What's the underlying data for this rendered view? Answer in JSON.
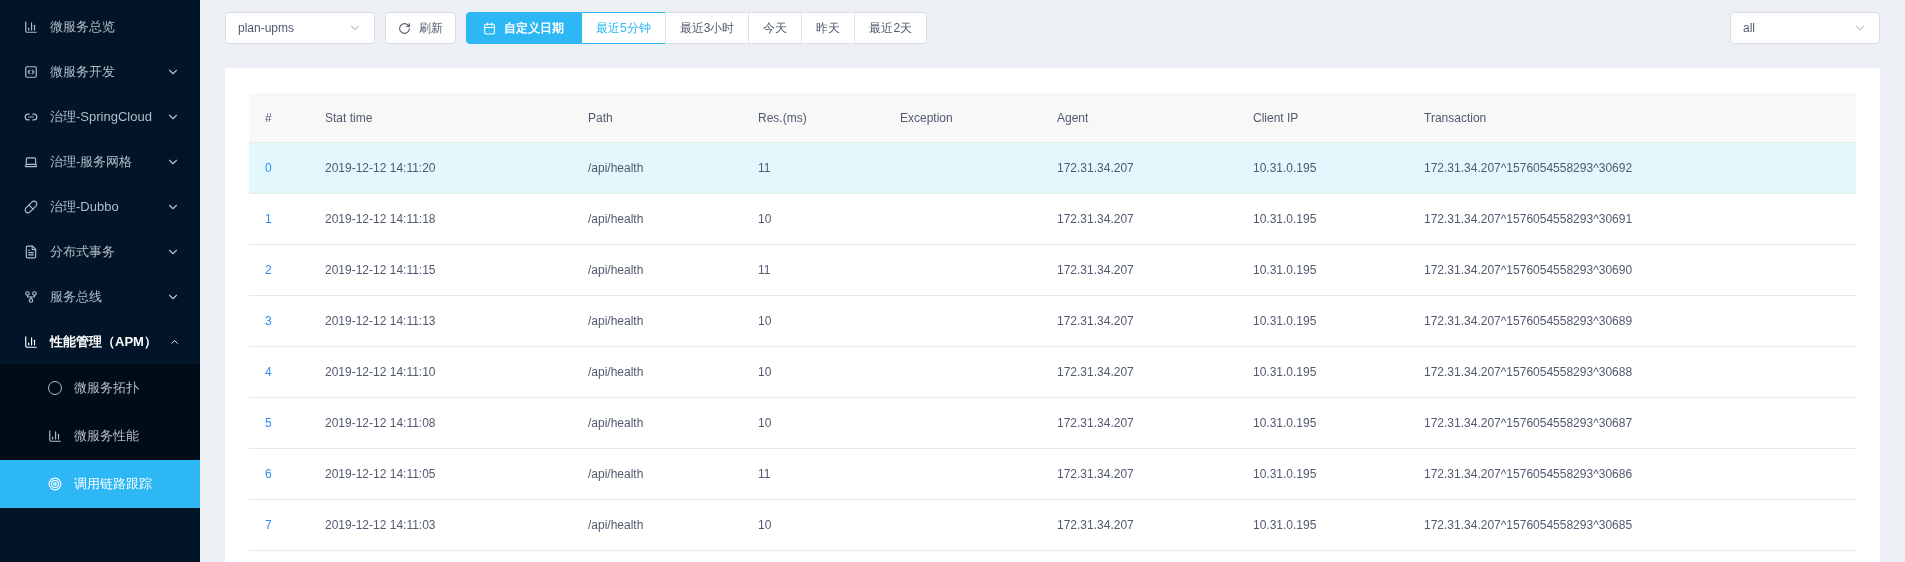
{
  "sidebar": {
    "items": [
      {
        "label": "微服务总览",
        "kind": "link",
        "expanded": false
      },
      {
        "label": "微服务开发",
        "kind": "group",
        "expanded": false
      },
      {
        "label": "治理-SpringCloud",
        "kind": "group",
        "expanded": false
      },
      {
        "label": "治理-服务网格",
        "kind": "group",
        "expanded": false
      },
      {
        "label": "治理-Dubbo",
        "kind": "group",
        "expanded": false
      },
      {
        "label": "分布式事务",
        "kind": "group",
        "expanded": false
      },
      {
        "label": "服务总线",
        "kind": "group",
        "expanded": false
      },
      {
        "label": "性能管理（APM）",
        "kind": "group",
        "expanded": true,
        "children": [
          {
            "label": "微服务拓扑",
            "selected": false
          },
          {
            "label": "微服务性能",
            "selected": false
          },
          {
            "label": "调用链路跟踪",
            "selected": true
          }
        ]
      }
    ]
  },
  "toolbar": {
    "service_select": {
      "value": "plan-upms"
    },
    "refresh_button": "刷新",
    "custom_date_button": "自定义日期",
    "ranges": [
      {
        "label": "最近5分钟",
        "selected": true
      },
      {
        "label": "最近3小时",
        "selected": false
      },
      {
        "label": "今天",
        "selected": false
      },
      {
        "label": "昨天",
        "selected": false
      },
      {
        "label": "最近2天",
        "selected": false
      }
    ],
    "filter_select": {
      "value": "all"
    }
  },
  "table": {
    "columns": [
      "#",
      "Stat time",
      "Path",
      "Res.(ms)",
      "Exception",
      "Agent",
      "Client IP",
      "Transaction"
    ],
    "rows": [
      {
        "selected": true,
        "cells": [
          "0",
          "2019-12-12 14:11:20",
          "/api/health",
          "11",
          "",
          "172.31.34.207",
          "10.31.0.195",
          "172.31.34.207^1576054558293^30692"
        ]
      },
      {
        "selected": false,
        "cells": [
          "1",
          "2019-12-12 14:11:18",
          "/api/health",
          "10",
          "",
          "172.31.34.207",
          "10.31.0.195",
          "172.31.34.207^1576054558293^30691"
        ]
      },
      {
        "selected": false,
        "cells": [
          "2",
          "2019-12-12 14:11:15",
          "/api/health",
          "11",
          "",
          "172.31.34.207",
          "10.31.0.195",
          "172.31.34.207^1576054558293^30690"
        ]
      },
      {
        "selected": false,
        "cells": [
          "3",
          "2019-12-12 14:11:13",
          "/api/health",
          "10",
          "",
          "172.31.34.207",
          "10.31.0.195",
          "172.31.34.207^1576054558293^30689"
        ]
      },
      {
        "selected": false,
        "cells": [
          "4",
          "2019-12-12 14:11:10",
          "/api/health",
          "10",
          "",
          "172.31.34.207",
          "10.31.0.195",
          "172.31.34.207^1576054558293^30688"
        ]
      },
      {
        "selected": false,
        "cells": [
          "5",
          "2019-12-12 14:11:08",
          "/api/health",
          "10",
          "",
          "172.31.34.207",
          "10.31.0.195",
          "172.31.34.207^1576054558293^30687"
        ]
      },
      {
        "selected": false,
        "cells": [
          "6",
          "2019-12-12 14:11:05",
          "/api/health",
          "11",
          "",
          "172.31.34.207",
          "10.31.0.195",
          "172.31.34.207^1576054558293^30686"
        ]
      },
      {
        "selected": false,
        "cells": [
          "7",
          "2019-12-12 14:11:03",
          "/api/health",
          "10",
          "",
          "172.31.34.207",
          "10.31.0.195",
          "172.31.34.207^1576054558293^30685"
        ]
      }
    ]
  }
}
